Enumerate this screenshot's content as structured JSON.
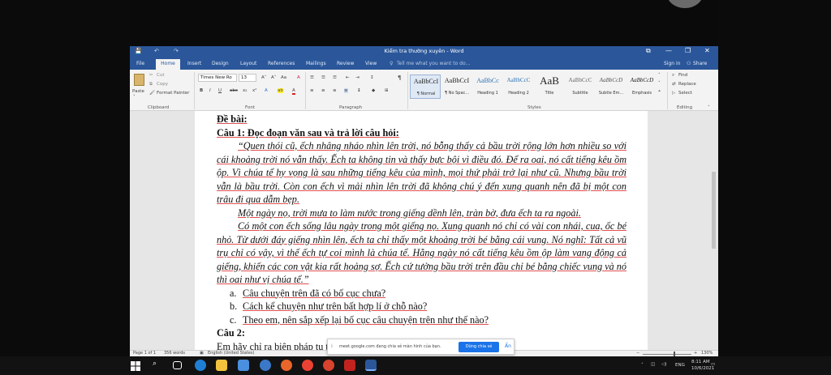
{
  "window": {
    "title": "Kiểm tra thường xuyên - Word",
    "controls": {
      "minimize": "—",
      "restore": "❐",
      "close": "✕",
      "ribbon_display": "⧉"
    }
  },
  "quick_access": {
    "save": "💾",
    "undo": "↶",
    "redo": "↷"
  },
  "tabs": [
    "File",
    "Home",
    "Insert",
    "Design",
    "Layout",
    "References",
    "Mailings",
    "Review",
    "View"
  ],
  "tell_me": "Tell me what you want to do...",
  "account": {
    "sign_in": "Sign in",
    "share": "Share"
  },
  "clipboard": {
    "paste": "Paste",
    "cut": "Cut",
    "copy": "Copy",
    "format_painter": "Format Painter",
    "group": "Clipboard"
  },
  "font": {
    "name": "Times New Ro",
    "size": "13",
    "grow": "A˄",
    "shrink": "A˅",
    "case": "Aa",
    "clear": "A",
    "bold": "B",
    "italic": "I",
    "underline": "U",
    "strike": "abc",
    "sub": "x₂",
    "sup": "x²",
    "effects": "A",
    "highlight": "ab",
    "color": "A",
    "group": "Font"
  },
  "paragraph": {
    "group": "Paragraph",
    "pilcrow": "¶"
  },
  "styles": {
    "group": "Styles",
    "items": [
      {
        "preview": "AaBbCcI",
        "name": "¶ Normal"
      },
      {
        "preview": "AaBbCcI",
        "name": "¶ No Spac..."
      },
      {
        "preview": "AaBbCc",
        "name": "Heading 1"
      },
      {
        "preview": "AaBbCcC",
        "name": "Heading 2"
      },
      {
        "preview": "AaB",
        "name": "Title"
      },
      {
        "preview": "AaBbCcC",
        "name": "Subtitle"
      },
      {
        "preview": "AaBbCcD",
        "name": "Subtle Em..."
      },
      {
        "preview": "AaBbCcD",
        "name": "Emphasis"
      }
    ]
  },
  "editing": {
    "find": "Find",
    "replace": "Replace",
    "select": "Select",
    "group": "Editing"
  },
  "document": {
    "heading": "Đề bài:",
    "q1": "Câu 1: Đọc đoạn văn sau và trả lời câu hỏi:",
    "p1": "“Quen thói cũ, ếch nhâng nháo nhìn lên trời, nó bỗng thấy cả bầu trời rộng lớn hơn nhiều so với cái khoảng trời nó vẫn thấy. Ếch ta không tin và thấy bực bội vì điều đó. Để ra oai, nó cất tiếng kêu ồm ộp. Vì chúa tể hy vọng là sau những tiếng kêu của mình, mọi thứ phải trở lại như cũ. Nhưng bầu trời vẫn là bầu trời. Còn con ếch vì mải nhìn lên trời đã không chú ý đến xung quanh nên đã bị một con trâu đi qua dẫm bẹp.",
    "p2": "Một ngày nọ, trời mưa to làm nước trong giếng dềnh lên, tràn bờ, đưa ếch ta ra ngoài.",
    "p3": "Có một con ếch sống lâu ngày trong một giếng nọ. Xung quanh nó chỉ có vài con nhái, cua, ốc bé nhỏ. Từ dưới đáy giếng nhìn lên, ếch ta chỉ thấy một khoảng trời bé bằng cái vung. Nó nghĩ: Tất cả vũ trụ chỉ có vậy, vì thế ếch tự coi mình là chúa tể. Hằng ngày nó cất tiếng kêu ồm ộp làm vang động cả giếng, khiến các con vật kia rất hoảng sợ. Ếch cứ tưởng bầu trời trên đầu chỉ bé bằng chiếc vung và nó thì oai như vị chúa tể.”",
    "items": [
      {
        "label": "a.",
        "text": "Câu chuyện trên đã có bố cục chưa?"
      },
      {
        "label": "b.",
        "text": "Cách kể chuyện như trên bất hợp lí ở chỗ nào?"
      },
      {
        "label": "c.",
        "text": "Theo em, nên sắp xếp lại bố cục câu chuyện trên như thế nào?"
      }
    ],
    "q2": "Câu 2:",
    "p4": "Em hãy chỉ ra biện pháp tu từ và nêu tác dụng của biện pháp tu"
  },
  "status": {
    "page": "Page 1 of 1",
    "words": "356 words",
    "language": "English (United States)",
    "zoom": "130%"
  },
  "share_bar": {
    "message": "meet.google.com đang chia sẻ màn hình của bạn.",
    "stop": "Dừng chia sẻ",
    "hide": "Ẩn"
  },
  "tray": {
    "lang": "ENG",
    "time": "8:11 AM",
    "date": "10/6/2021"
  }
}
